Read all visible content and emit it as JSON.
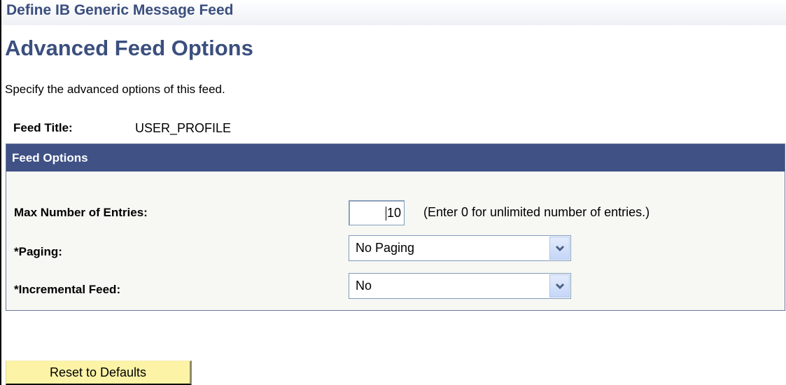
{
  "header": {
    "app_title": "Define IB Generic Message Feed",
    "page_title": "Advanced Feed Options",
    "instructions": "Specify the advanced options of this feed."
  },
  "feed": {
    "title_label": "Feed Title:",
    "title_value": "USER_PROFILE"
  },
  "feed_options": {
    "header": "Feed Options",
    "max_entries": {
      "label": "Max Number of Entries:",
      "value": "10",
      "hint": "(Enter 0 for unlimited number of entries.)"
    },
    "paging": {
      "label": "*Paging:",
      "selected": "No Paging"
    },
    "incremental_feed": {
      "label": "*Incremental Feed:",
      "selected": "No"
    }
  },
  "actions": {
    "reset_label": "Reset to Defaults"
  },
  "colors": {
    "title_blue": "#3b4f7e",
    "group_header_bg": "#3f5185",
    "button_bg": "#fcf3a6"
  },
  "icons": {
    "dropdown": "chevron-down-icon"
  }
}
